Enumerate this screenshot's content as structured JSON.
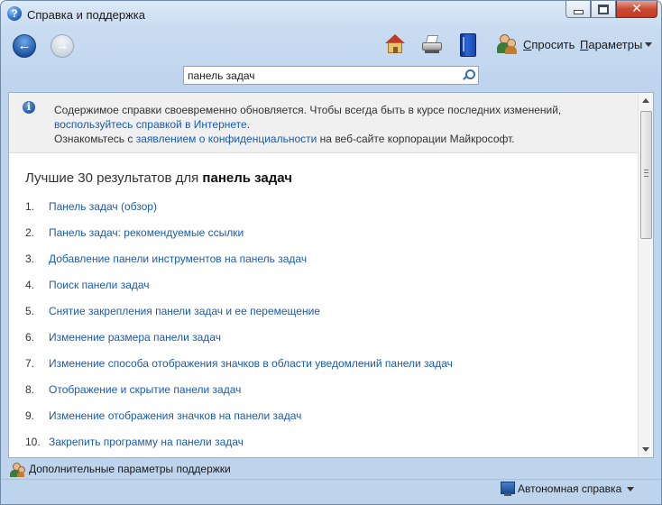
{
  "window": {
    "title": "Справка и поддержка"
  },
  "toolbar": {
    "ask_prefix": "С",
    "ask_rest": "просить",
    "options_prefix": "П",
    "options_rest": "араметры"
  },
  "search": {
    "value": "панель задач"
  },
  "notice": {
    "line1": "Содержимое справки своевременно обновляется. Чтобы всегда быть в курсе последних изменений,",
    "line1_link": "воспользуйтесь справкой в Интернете",
    "line1_end": ".",
    "line2_start": "Ознакомьтесь с ",
    "line2_link": "заявлением о конфиденциальности",
    "line2_end": " на веб-сайте корпорации Майкрософт."
  },
  "results": {
    "heading_prefix": "Лучшие 30 результатов для ",
    "heading_query": "панель задач",
    "items": [
      {
        "num": "1.",
        "title": "Панель задач (обзор)"
      },
      {
        "num": "2.",
        "title": "Панель задач: рекомендуемые ссылки"
      },
      {
        "num": "3.",
        "title": "Добавление панели инструментов на панель задач"
      },
      {
        "num": "4.",
        "title": "Поиск панели задач"
      },
      {
        "num": "5.",
        "title": "Снятие закрепления панели задач и ее перемещение"
      },
      {
        "num": "6.",
        "title": "Изменение размера панели задач"
      },
      {
        "num": "7.",
        "title": "Изменение способа отображения значков в области уведомлений панели задач"
      },
      {
        "num": "8.",
        "title": "Отображение и скрытие панели задач"
      },
      {
        "num": "9.",
        "title": "Изменение отображения значков на панели задач"
      },
      {
        "num": "10.",
        "title": "Закрепить программу на панели задач"
      }
    ]
  },
  "footer": {
    "support_link": "Дополнительные параметры поддержки",
    "status": "Автономная справка"
  }
}
